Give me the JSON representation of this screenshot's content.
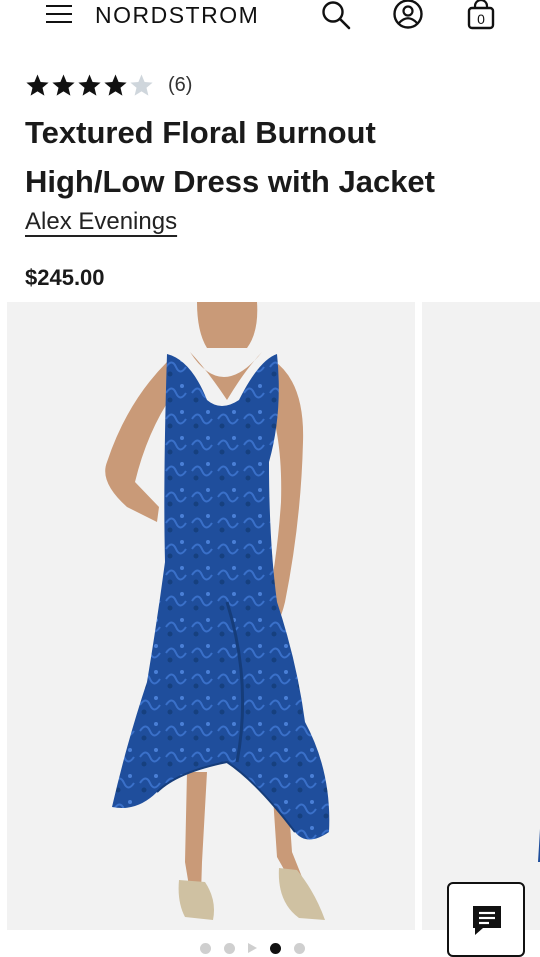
{
  "header": {
    "logo": "NORDSTROM",
    "icons": [
      "menu-icon",
      "search-icon",
      "account-icon",
      "shopping-bag-icon"
    ],
    "bag_count": "0"
  },
  "product": {
    "rating": 4,
    "rating_max": 5,
    "review_count": "(6)",
    "title": "Textured Floral Burnout High/Low Dress with Jacket",
    "brand": "Alex Evenings",
    "price": "$245.00"
  },
  "gallery": {
    "images": [
      "dress-front-view",
      "dress-side-view"
    ],
    "indicators": [
      "dot",
      "dot",
      "video",
      "dot",
      "dot"
    ],
    "active_index": 3
  },
  "chat": {
    "icon": "chat-icon"
  },
  "colors": {
    "dress_blue": "#1f4e9c",
    "star_filled": "#111111",
    "star_empty": "#cfd6dc",
    "background": "#ffffff",
    "photo_background": "#f2f2f2"
  }
}
